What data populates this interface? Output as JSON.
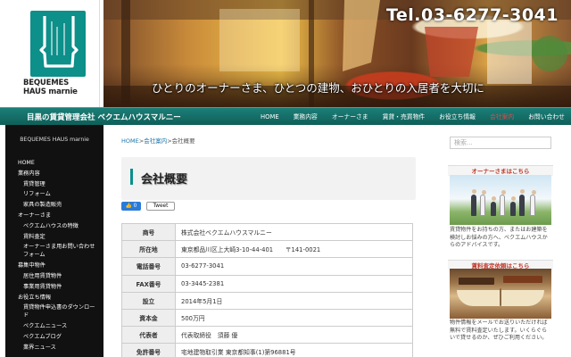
{
  "header": {
    "logo_text": "BEQUEMES\nHAUS marnie",
    "tel": "Tel.03-6277-3041",
    "catch": "ひとりのオーナーさま、ひとつの建物、おひとりの入居者を大切に"
  },
  "navbar": {
    "title": "目黒の賃貸管理会社 ベクエムハウスマルニー",
    "menu": [
      "HOME",
      "業務内容",
      "オーナーさま",
      "賃貸・売買物件",
      "お役立ち情報",
      "会社案内",
      "お問い合わせ"
    ],
    "active_index": 5
  },
  "sidebar": {
    "title": "BEQUEMES HAUS marnie",
    "items": [
      {
        "label": "HOME",
        "level": 0
      },
      {
        "label": "業務内容",
        "level": 0
      },
      {
        "label": "賃貸管理",
        "level": 1
      },
      {
        "label": "リフォーム",
        "level": 1
      },
      {
        "label": "家具の製造販売",
        "level": 1
      },
      {
        "label": "オーナーさま",
        "level": 0
      },
      {
        "label": "ベクエムハウスの特徴",
        "level": 1
      },
      {
        "label": "賃料査定",
        "level": 1
      },
      {
        "label": "オーナーさま用お問い合わせフォーム",
        "level": 1
      },
      {
        "label": "募集中物件",
        "level": 0
      },
      {
        "label": "居住用賃貸物件",
        "level": 1
      },
      {
        "label": "事業用賃貸物件",
        "level": 1
      },
      {
        "label": "お役立ち情報",
        "level": 0
      },
      {
        "label": "賃貸物件申込書のダウンロード",
        "level": 1
      },
      {
        "label": "ベクエムニュース",
        "level": 1
      },
      {
        "label": "ベクエムブログ",
        "level": 1
      },
      {
        "label": "業界ニュース",
        "level": 1
      }
    ]
  },
  "main": {
    "breadcrumb": {
      "home": "HOME",
      "sep": ">",
      "parent": "会社案内",
      "current": "会社概要"
    },
    "heading": "会社概要",
    "share": {
      "facebook": "0",
      "tweet": "Tweet"
    },
    "table": [
      {
        "label": "商号",
        "value": "株式会社ベクエムハウスマルニー"
      },
      {
        "label": "所在地",
        "value": "東京都品川区上大崎3-10-44-401　　〒141-0021"
      },
      {
        "label": "電話番号",
        "value": "03-6277-3041"
      },
      {
        "label": "FAX番号",
        "value": "03-3445-2381"
      },
      {
        "label": "設立",
        "value": "2014年5月1日"
      },
      {
        "label": "資本金",
        "value": "500万円"
      },
      {
        "label": "代表者",
        "value": "代表取締役　須藤 優"
      },
      {
        "label": "免許番号",
        "value": "宅地建物取引業 東京都知事(1)第96881号"
      }
    ]
  },
  "right_sidebar": {
    "search_placeholder": "検索...",
    "owner_panel": {
      "heading": "オーナーさまはこちら",
      "text": "賃貸物件をお持ちの方、またはお建築を検討しお悩みの方へ、ベクエムハウスからのアドバイスです。"
    },
    "assessment_panel": {
      "heading": "賃料査定依頼はこちら",
      "text": "物件情報をメールでお送りいただければ無料で賃料査定いたします。いくらぐらいで貸せるのか、ぜひご利用ください。"
    }
  },
  "colors": {
    "accent": "#0d8f8a",
    "nav_active": "#e24a4a",
    "panel_heading": "#c0392b"
  }
}
